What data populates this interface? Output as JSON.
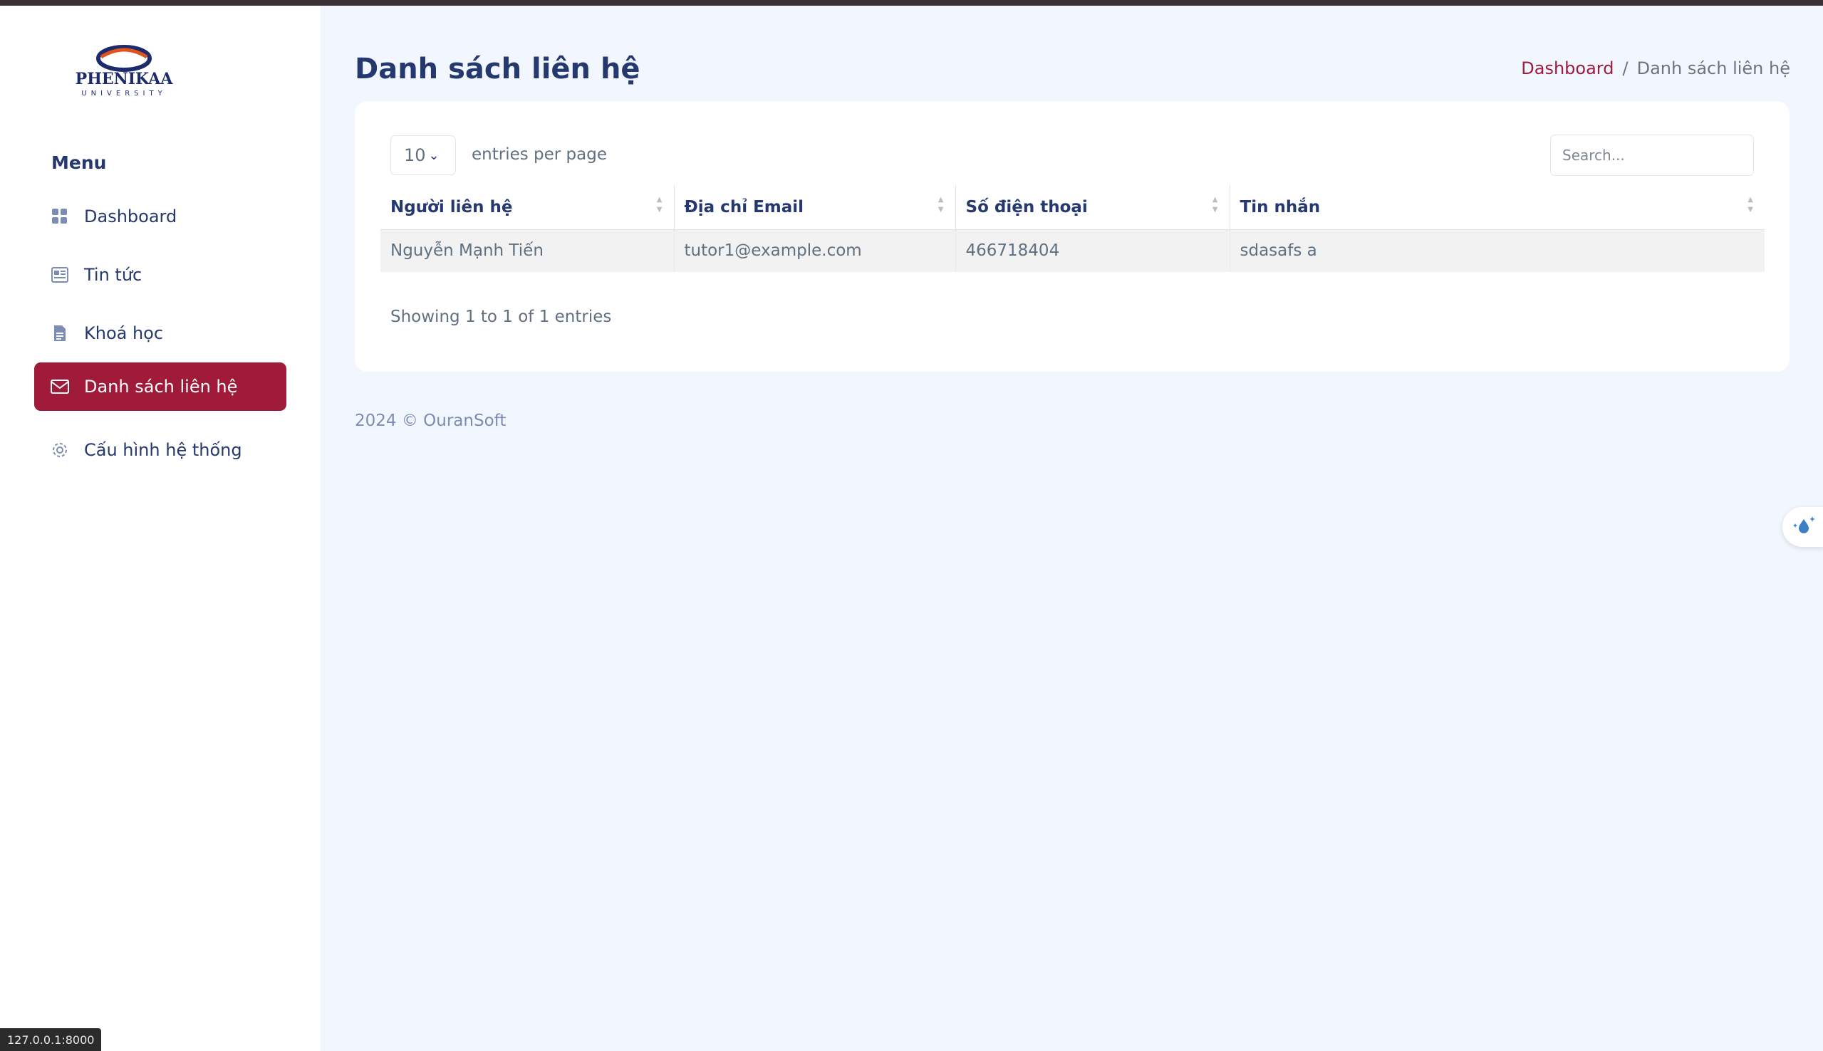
{
  "brand": {
    "logo_text": "PHENIKAA",
    "logo_subtext": "UNIVERSITY"
  },
  "sidebar": {
    "menu_title": "Menu",
    "items": [
      {
        "label": "Dashboard",
        "icon": "grid-icon",
        "active": false
      },
      {
        "label": "Tin tức",
        "icon": "newspaper-icon",
        "active": false
      },
      {
        "label": "Khoá học",
        "icon": "document-icon",
        "active": false
      },
      {
        "label": "Danh sách liên hệ",
        "icon": "envelope-icon",
        "active": true
      },
      {
        "label": "Cấu hình hệ thống",
        "icon": "gear-icon",
        "active": false
      }
    ]
  },
  "page": {
    "title": "Danh sách liên hệ",
    "breadcrumb": {
      "link": "Dashboard",
      "separator": "/",
      "current": "Danh sách liên hệ"
    }
  },
  "table": {
    "per_page_value": "10",
    "per_page_text": "entries per page",
    "search_placeholder": "Search...",
    "columns": [
      "Người liên hệ",
      "Địa chỉ Email",
      "Số điện thoại",
      "Tin nhắn"
    ],
    "rows": [
      [
        "Nguyễn Mạnh Tiến",
        "tutor1@example.com",
        "466718404",
        "sdasafs a"
      ]
    ],
    "info": "Showing 1 to 1 of 1 entries"
  },
  "footer": {
    "text": "2024 © OuranSoft"
  },
  "status_bar": {
    "url": "127.0.0.1:8000"
  },
  "colors": {
    "accent": "#a01b3a",
    "heading": "#25396f",
    "background": "#f2f7ff"
  }
}
